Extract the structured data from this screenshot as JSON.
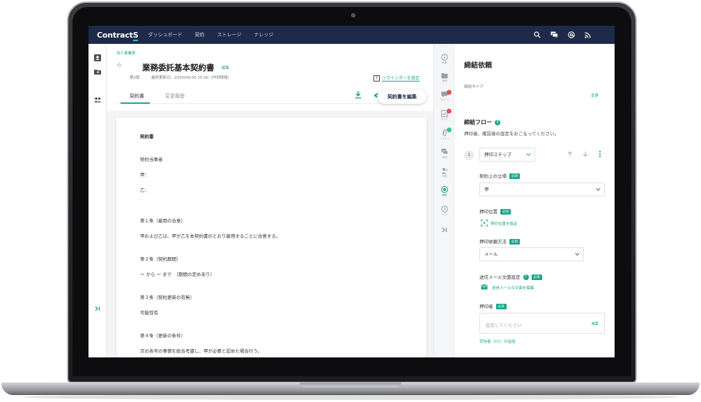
{
  "topbar": {
    "logo": "ContractS",
    "nav": [
      "ダッシュボード",
      "契約",
      "ストレージ",
      "ナレッジ"
    ]
  },
  "icons": {
    "top": [
      "search-icon",
      "chat-icon",
      "mention-icon",
      "rss-icon"
    ],
    "left_rail": [
      "contacts-book-icon",
      "folder-user-icon",
      "users-icon",
      "expand-icon"
    ]
  },
  "contract": {
    "breadcrumb": "法人事業部",
    "title": "業務委託基本契約書",
    "title_edit": "編集",
    "version": "第2版",
    "updated": "最終更新日：2020/04/30 15:00（作例様格）",
    "reminder": "リマインダーを設定",
    "tabs": [
      "契約書",
      "変更履歴"
    ],
    "edit_button": "契約書を編集"
  },
  "document": {
    "lines": [
      "契約書",
      "契約当事者",
      "甲：",
      "乙：",
      "第１条（雇用の合意）",
      "甲および乙は、甲が乙を本契約書のとおり雇用することに合意する。",
      "第２条（契約期間）",
      "ー から ー まで　（期間の定めあり）",
      "第３条（契約更新の有無）",
      "可能性有",
      "第４条（更新の条件）",
      "次の各号の事情を総合考慮し、甲が必要と認めた場合行う。"
    ]
  },
  "strip": {
    "items": [
      {
        "icon": "info-icon",
        "caption": "概要"
      },
      {
        "icon": "folder-icon",
        "caption": "格納"
      },
      {
        "icon": "comment-icon",
        "caption": "コメント",
        "badge": "red"
      },
      {
        "icon": "task-icon",
        "caption": "タスク",
        "badge": "red"
      },
      {
        "icon": "paperclip-icon",
        "caption": "ファイル",
        "badge": "green"
      },
      {
        "icon": "discussion-icon",
        "caption": "承認"
      },
      {
        "icon": "person-check-icon",
        "caption": "承認"
      },
      {
        "icon": "stamp-icon",
        "caption": "締結"
      },
      {
        "icon": "clock-icon",
        "caption": "ログ"
      },
      {
        "icon": "collapse-icon",
        "caption": ""
      }
    ]
  },
  "panel": {
    "title": "締結依頼",
    "type_label": "締結タイプ",
    "change": "変更",
    "flow_title": "締結フロー",
    "flow_desc": "押印者、確認者の設定をおこなってください。",
    "step_number": "1",
    "step_select": "押印ステップ",
    "position_label": "契約上の立場",
    "position_value": "甲",
    "stamp_pos_label": "押印位置",
    "stamp_pos_link": "押印位置を設定",
    "method_label": "押印依頼方法",
    "method_value": "メール",
    "mail_label": "送信メール文面設定",
    "mail_link": "送信メールの文面を編集",
    "signer_label": "押印者",
    "signer_placeholder": "設定してください",
    "signer_edit": "編集",
    "cc_link": "受信者（CC）の追加",
    "required": "必須"
  }
}
